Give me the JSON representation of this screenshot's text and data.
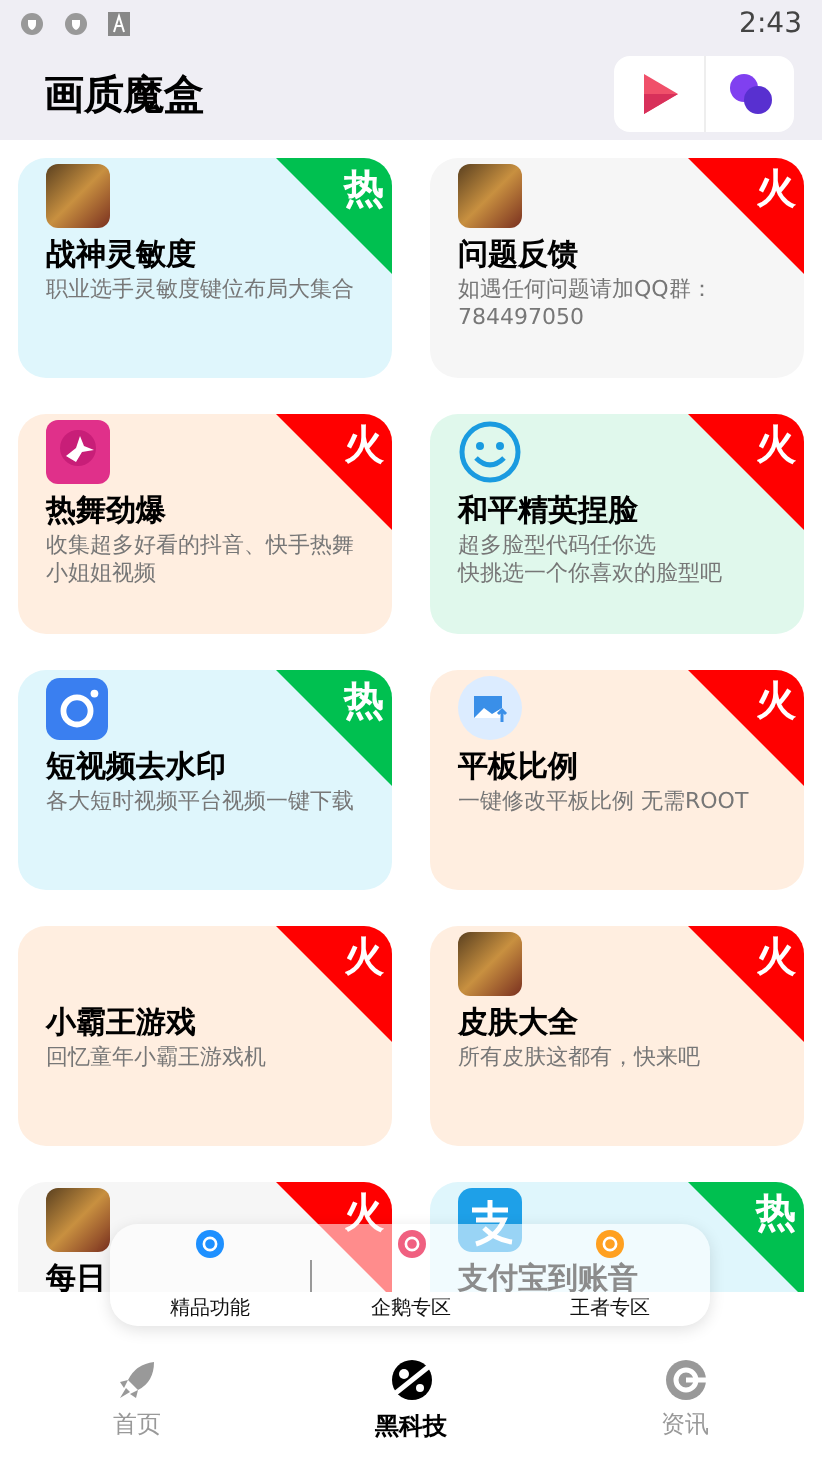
{
  "status_bar": {
    "time": "2:43"
  },
  "header": {
    "title": "画质魔盒"
  },
  "cards": [
    {
      "title": "战神灵敏度",
      "lines": [
        "职业选手灵敏度键位布局大集合"
      ],
      "color": "#dff6fc",
      "kind": "game",
      "badge": {
        "text": "热",
        "color": "#00c050"
      }
    },
    {
      "title": "问题反馈",
      "lines": [
        "如遇任何问题请加QQ群：",
        "784497050"
      ],
      "color": "#f6f6f6",
      "kind": "game",
      "badge": {
        "text": "火",
        "color": "#ff0000"
      }
    },
    {
      "title": "热舞劲爆",
      "lines": [
        "收集超多好看的抖音、快手热舞",
        "小姐姐视频"
      ],
      "color": "#ffeee0",
      "kind": "dance",
      "badge": {
        "text": "火",
        "color": "#ff0000"
      }
    },
    {
      "title": "和平精英捏脸",
      "lines": [
        "超多脸型代码任你选",
        "快挑选一个你喜欢的脸型吧"
      ],
      "color": "#e0f8ec",
      "kind": "smile",
      "badge": {
        "text": "火",
        "color": "#ff0000"
      }
    },
    {
      "title": "短视频去水印",
      "lines": [
        "各大短时视频平台视频一键下载"
      ],
      "color": "#dff6fc",
      "kind": "camera",
      "badge": {
        "text": "热",
        "color": "#00c050"
      }
    },
    {
      "title": "平板比例",
      "lines": [
        "一键修改平板比例 无需ROOT"
      ],
      "color": "#ffeee0",
      "kind": "picture",
      "badge": {
        "text": "火",
        "color": "#ff0000"
      }
    },
    {
      "title": "小霸王游戏",
      "lines": [
        "回忆童年小霸王游戏机"
      ],
      "color": "#ffeee0",
      "kind": "plain",
      "badge": {
        "text": "火",
        "color": "#ff0000"
      }
    },
    {
      "title": "皮肤大全",
      "lines": [
        "所有皮肤这都有，快来吧"
      ],
      "color": "#ffeee0",
      "kind": "game",
      "badge": {
        "text": "火",
        "color": "#ff0000"
      }
    },
    {
      "title": "每日",
      "color": "#f6f6f6",
      "kind": "game",
      "badge": {
        "text": "火",
        "color": "#ff0000"
      }
    },
    {
      "title": "支付宝到账音",
      "color": "#dff6fc",
      "kind": "pay",
      "badge": {
        "text": "热",
        "color": "#00c050"
      }
    }
  ],
  "quick_menu": [
    {
      "label": "精品功能",
      "color": "#1e90ff"
    },
    {
      "label": "企鹅专区",
      "color": "#f06080"
    },
    {
      "label": "王者专区",
      "color": "#ffa020"
    }
  ],
  "bottom_nav": [
    {
      "label": "首页",
      "kind": "rocket",
      "selected": false
    },
    {
      "label": "黑科技",
      "kind": "planet",
      "selected": true
    },
    {
      "label": "资讯",
      "kind": "coin",
      "selected": false
    }
  ]
}
